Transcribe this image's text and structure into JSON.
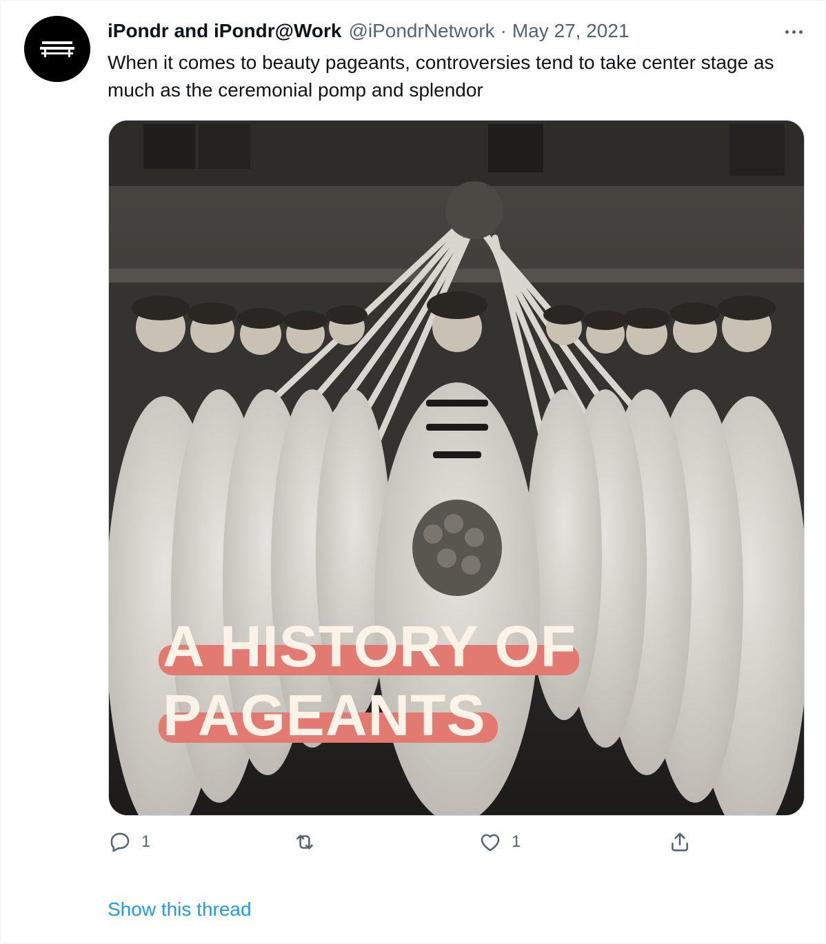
{
  "tweet": {
    "author_name": "iPondr and iPondr@Work",
    "author_handle": "@iPondrNetwork",
    "separator": "·",
    "date": "May 27, 2021",
    "text": "When it comes to beauty pageants, controversies tend to take center stage as much as the ceremonial pomp and splendor",
    "media": {
      "title_line1": "A HISTORY OF",
      "title_line2": "PAGEANTS",
      "title_highlight_color": "#e37a71",
      "title_text_color": "#fbf3e8"
    },
    "actions": {
      "reply_count": "1",
      "retweet_count": "",
      "like_count": "1"
    },
    "show_thread": "Show this thread"
  },
  "icons": {
    "avatar": "bench-logo-icon",
    "more": "more-dots-icon",
    "reply": "reply-icon",
    "retweet": "retweet-icon",
    "like": "heart-icon",
    "share": "share-icon"
  },
  "colors": {
    "text_primary": "#0f1419",
    "text_secondary": "#536471",
    "link": "#1d9bf0"
  }
}
